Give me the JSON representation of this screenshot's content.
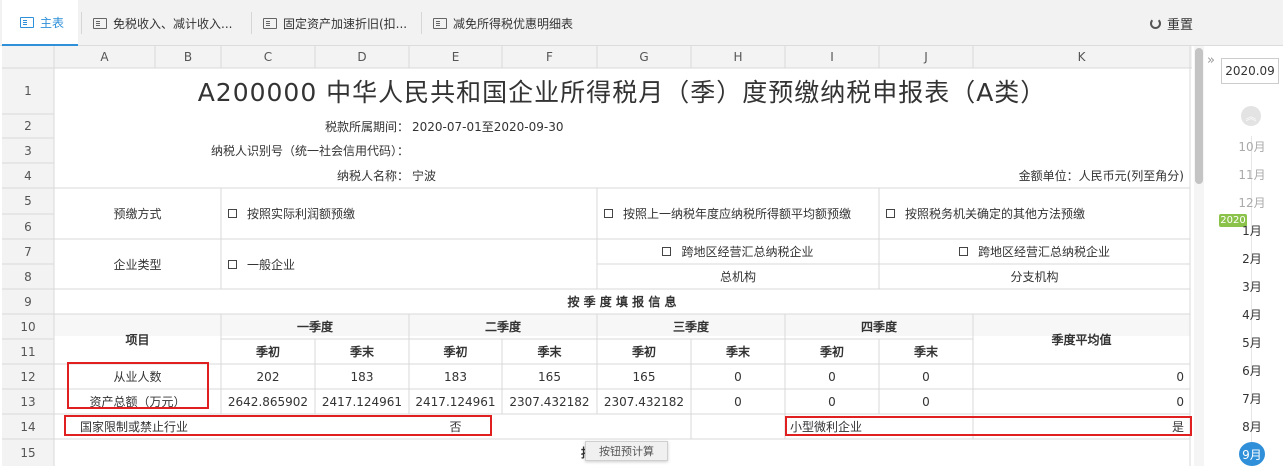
{
  "tabs": [
    {
      "label": "主表",
      "active": true
    },
    {
      "label": "免税收入、减计收入..."
    },
    {
      "label": "固定资产加速折旧(扣..."
    },
    {
      "label": "减免所得税优惠明细表"
    }
  ],
  "reset_label": "重置",
  "grid": {
    "col_headers": [
      "A",
      "B",
      "C",
      "D",
      "E",
      "F",
      "G",
      "H",
      "I",
      "J",
      "K"
    ],
    "row_headers": [
      "1",
      "2",
      "3",
      "4",
      "5",
      "6",
      "7",
      "8",
      "9",
      "10",
      "11",
      "12",
      "13",
      "14",
      "15"
    ],
    "title": "A200000 中华人民共和国企业所得税月（季）度预缴纳税申报表（A类）",
    "period_label": "税款所属期间：",
    "period_value": "2020-07-01至2020-09-30",
    "taxid_label": "纳税人识别号（统一社会信用代码）：",
    "name_label": "纳税人名称：",
    "name_value": "宁波",
    "unit_label": "金额单位：人民币元(列至角分)",
    "prepay_label": "预缴方式",
    "prepay_opt1": "按照实际利润额预缴",
    "prepay_opt2": "按照上一纳税年度应纳税所得额平均额预缴",
    "prepay_opt3": "按照税务机关确定的其他方法预缴",
    "ent_label": "企业类型",
    "ent_opt1": "一般企业",
    "ent_opt2": "跨地区经营汇总纳税企业",
    "ent_opt2_sub": "总机构",
    "ent_opt3": "跨地区经营汇总纳税企业",
    "ent_opt3_sub": "分支机构",
    "quarter_info": "按 季 度 填 报 信 息",
    "item_label": "项目",
    "q1": "一季度",
    "q2": "二季度",
    "q3": "三季度",
    "q4": "四季度",
    "avg_label": "季度平均值",
    "start_label": "季初",
    "end_label": "季末",
    "row12": {
      "label": "从业人数",
      "values": [
        "202",
        "183",
        "183",
        "165",
        "165",
        "0",
        "0",
        "0"
      ],
      "avg": "0"
    },
    "row13": {
      "label": "资产总额（万元）",
      "values": [
        "2642.865902",
        "2417.124961",
        "2417.124961",
        "2307.432182",
        "2307.432182",
        "0",
        "0",
        "0"
      ],
      "avg": "0"
    },
    "row14": {
      "label": "国家限制或禁止行业",
      "value": "否",
      "small_label": "小型微利企业",
      "small_value": "是"
    },
    "row15_fragment": "按"
  },
  "tooltip": "按钮预计算",
  "sidebar": {
    "date": "2020.09",
    "months": [
      "10月",
      "11月",
      "12月",
      "1月",
      "2月",
      "3月",
      "4月",
      "5月",
      "6月",
      "7月",
      "8月"
    ],
    "year_badge": "2020",
    "current_month": "9月"
  },
  "colors": {
    "accent": "#2f8fd8",
    "highlight": "#e02020",
    "year_badge": "#8bc34a"
  }
}
